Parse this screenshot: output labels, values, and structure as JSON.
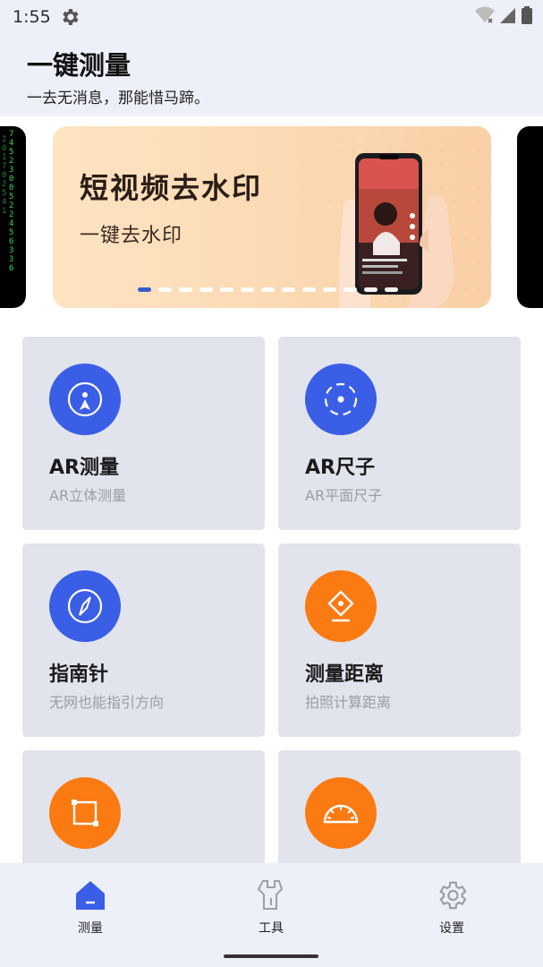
{
  "status_bar": {
    "time": "1:55"
  },
  "header": {
    "title": "一键测量",
    "subtitle": "一去无消息，那能惜马蹄。"
  },
  "banner": {
    "title": "短视频去水印",
    "subtitle": "一键去水印",
    "dot_count": 13,
    "active_dot": 0,
    "matrix_left": "7\n4\n5\n2\n3\n0\n0\n5\n2\n2\n4\n5\n6\n3\n3\n6"
  },
  "cards": [
    {
      "title": "AR测量",
      "subtitle": "AR立体测量",
      "icon": "ar-measure-icon",
      "color": "blue"
    },
    {
      "title": "AR尺子",
      "subtitle": "AR平面尺子",
      "icon": "ar-ruler-icon",
      "color": "blue"
    },
    {
      "title": "指南针",
      "subtitle": "无网也能指引方向",
      "icon": "compass-icon",
      "color": "blue"
    },
    {
      "title": "测量距离",
      "subtitle": "拍照计算距离",
      "icon": "distance-icon",
      "color": "orange"
    },
    {
      "title": "",
      "subtitle": "",
      "icon": "frame-icon",
      "color": "orange"
    },
    {
      "title": "",
      "subtitle": "",
      "icon": "protractor-icon",
      "color": "orange"
    }
  ],
  "nav": {
    "items": [
      {
        "label": "测量",
        "active": true
      },
      {
        "label": "工具",
        "active": false
      },
      {
        "label": "设置",
        "active": false
      }
    ]
  },
  "colors": {
    "accent_blue": "#3b5ee6",
    "accent_orange": "#fb7a12",
    "header_bg": "#eef0f9",
    "card_bg": "#e1e4ec"
  }
}
